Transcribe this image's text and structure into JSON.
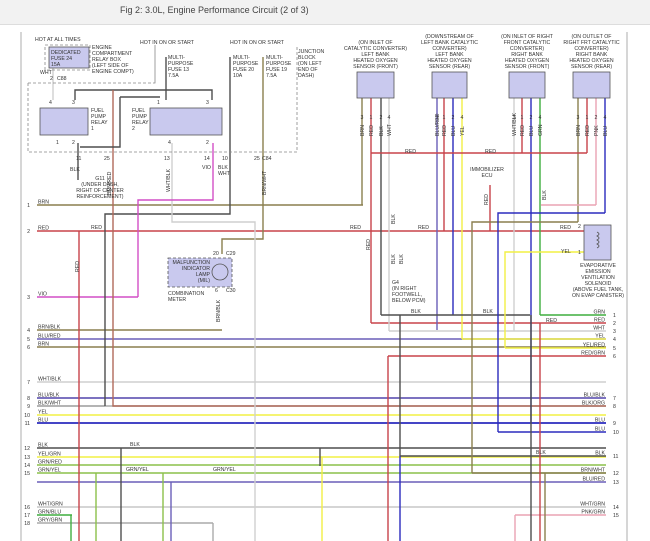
{
  "title": "Fig 2: 3.0L, Engine Performance Circuit (2 of 3)",
  "wire_colors": {
    "RED": "#c8434a",
    "BRN": "#8a7f4e",
    "BLU": "#2b2bbd",
    "YEL": "#f2f044",
    "GRN": "#3fae3f",
    "VIO": "#d24fc6",
    "BLK": "#4e4e4e",
    "WHT": "#cfcfcf",
    "PNK": "#eaa3b3",
    "GRNYEL": "#8cc04a",
    "BLURED": "#6a5fb8",
    "BRNRED": "#b06a5a",
    "GRY": "#aaaaaa"
  },
  "top": {
    "hot_all": "HOT AT ALL TIMES",
    "fuse24": [
      "DEDICATED",
      "FUSE 24",
      "15A"
    ],
    "relay_box": [
      "ENGINE",
      "COMPARTMENT",
      "RELAY BOX",
      "(LEFT SIDE OF",
      "ENGINE COMPT)"
    ],
    "wht": "WHT",
    "c88_pin": "2",
    "c88": "C88",
    "hot_on1": "HOT IN ON OR START",
    "hot_on2": "HOT IN ON OR START",
    "fuse13": [
      "MULTI-",
      "PURPOSE",
      "FUSE 13",
      "7.5A"
    ],
    "fuse20": [
      "MULTI-",
      "PURPOSE",
      "FUSE 20",
      "10A"
    ],
    "fuse19": [
      "MULTI-",
      "PURPOSE",
      "FUSE 19",
      "7.5A"
    ],
    "junction": [
      "JUNCTION",
      "BLOCK",
      "(ON LEFT",
      "END OF",
      "DASH)"
    ],
    "relay1": [
      "FUEL",
      "PUMP",
      "RELAY",
      "1"
    ],
    "relay1_pins": [
      "4",
      "3",
      "1",
      "2"
    ],
    "relay2": [
      "FUEL",
      "PUMP",
      "RELAY",
      "2"
    ],
    "relay2_pins": [
      "1",
      "3",
      "4",
      "2"
    ],
    "jb_pins": [
      "11",
      "25",
      "13",
      "14",
      "10",
      "25",
      "C84"
    ],
    "blk": "BLK",
    "vio": "VIO",
    "blk_wht": [
      "BLK",
      "WHT"
    ],
    "brn_red": "BRN/RED",
    "wht_blk": "WHT/BLK",
    "brn_wht": "BRN/WHT",
    "g11": [
      "G11",
      "(UNDER DASH,",
      "RIGHT OF CENTER",
      "REINFORCEMENT)"
    ]
  },
  "mil": {
    "label": [
      "MALFUNCTION",
      "INDICATOR",
      "LAMP",
      "(MIL)"
    ],
    "pin_top": "20",
    "conn_top": "C29",
    "pin_bot": "6",
    "conn_bot": "C30",
    "meter": [
      "COMBINATION",
      "METER"
    ],
    "wire": "BRN/BLK"
  },
  "left_rows": [
    {
      "n": "1",
      "label": "BRN"
    },
    {
      "n": "2",
      "label": "RED"
    },
    {
      "n": "3",
      "label": "VIO"
    },
    {
      "n": "4",
      "label": "BRN/BLK"
    },
    {
      "n": "5",
      "label": "BLU/RED"
    },
    {
      "n": "6",
      "label": "BRN"
    },
    {
      "n": "7",
      "label": "WHT/BLK"
    },
    {
      "n": "8",
      "label": "BLU/BLK"
    },
    {
      "n": "9",
      "label": "BLK/WHT"
    },
    {
      "n": "10",
      "label": "YEL"
    },
    {
      "n": "11",
      "label": "BLU"
    },
    {
      "n": "12",
      "label": "BLK"
    },
    {
      "n": "13",
      "label": "YEL/GRN"
    },
    {
      "n": "14",
      "label": "GRN/RED"
    },
    {
      "n": "15",
      "label": "GRN/YEL"
    },
    {
      "n": "16",
      "label": "WHT/GRN"
    },
    {
      "n": "17",
      "label": "GRN/BLU"
    },
    {
      "n": "18",
      "label": "GRY/GRN"
    }
  ],
  "right_rows": [
    {
      "n": "1",
      "label": "GRN"
    },
    {
      "n": "2",
      "label": "RED"
    },
    {
      "n": "3",
      "label": "WHT"
    },
    {
      "n": "4",
      "label": "YEL"
    },
    {
      "n": "5",
      "label": "YEL/RED"
    },
    {
      "n": "6",
      "label": "RED/GRN"
    },
    {
      "n": "7",
      "label": "BLU/BLK"
    },
    {
      "n": "8",
      "label": "BLK/ORG"
    },
    {
      "n": "9",
      "label": "BLU"
    },
    {
      "n": "10",
      "label": "BLU"
    },
    {
      "n": "11",
      "label": "BLK"
    },
    {
      "n": "12",
      "label": "BRN/WHT"
    },
    {
      "n": "13",
      "label": "BLU/RED"
    },
    {
      "n": "14",
      "label": "WHT/GRN"
    },
    {
      "n": "15",
      "label": "PNK/GRN"
    }
  ],
  "sensors": [
    {
      "caption": [
        "(ON INLET OF",
        "CATALYTIC CONVERTER)",
        "LEFT BANK",
        "HEATED OXYGEN",
        "SENSOR (FRONT)"
      ],
      "wires": [
        "BRN",
        "RED",
        "BLK",
        "WHT"
      ]
    },
    {
      "caption": [
        "(DOWNSTREAM OF",
        "LEFT BANK CATALYTIC",
        "CONVERTER)",
        "LEFT BANK",
        "HEATED OXYGEN",
        "SENSOR (REAR)"
      ],
      "wires": [
        "BLU/RED",
        "RED",
        "BLU",
        "YEL"
      ]
    },
    {
      "caption": [
        "(ON INLET OF RIGHT",
        "FRONT CATALYTIC",
        "CONVERTER)",
        "RIGHT BANK",
        "HEATED OXYGEN",
        "SENSOR (FRONT)"
      ],
      "wires": [
        "WHT/BLK",
        "RED",
        "BLU",
        "GRN"
      ]
    },
    {
      "caption": [
        "(ON OUTLET OF",
        "RIGHT FRT CATALYTIC",
        "CONVERTER)",
        "RIGHT BANK",
        "HEATED OXYGEN",
        "SENSOR (REAR)"
      ],
      "wires": [
        "BRN",
        "RED",
        "PNK",
        "BLU"
      ]
    }
  ],
  "sensor_pins": [
    "3",
    "1",
    "2",
    "4"
  ],
  "misc": {
    "red": "RED",
    "blk": "BLK",
    "yel": "YEL",
    "grn_yel": "GRN/YEL",
    "immobilizer": [
      "IMMOBILIZER",
      "ECU"
    ],
    "g4": [
      "G4",
      "(IN RIGHT",
      "FOOTWELL,",
      "BELOW PCM)"
    ],
    "evap": [
      "EVAPORATIVE",
      "EMISSION",
      "VENTILATION",
      "SOLENOID",
      "(ABOVE FUEL TANK,",
      "ON EVAP CANISTER)"
    ],
    "evap_pins": [
      "2",
      "1"
    ]
  }
}
